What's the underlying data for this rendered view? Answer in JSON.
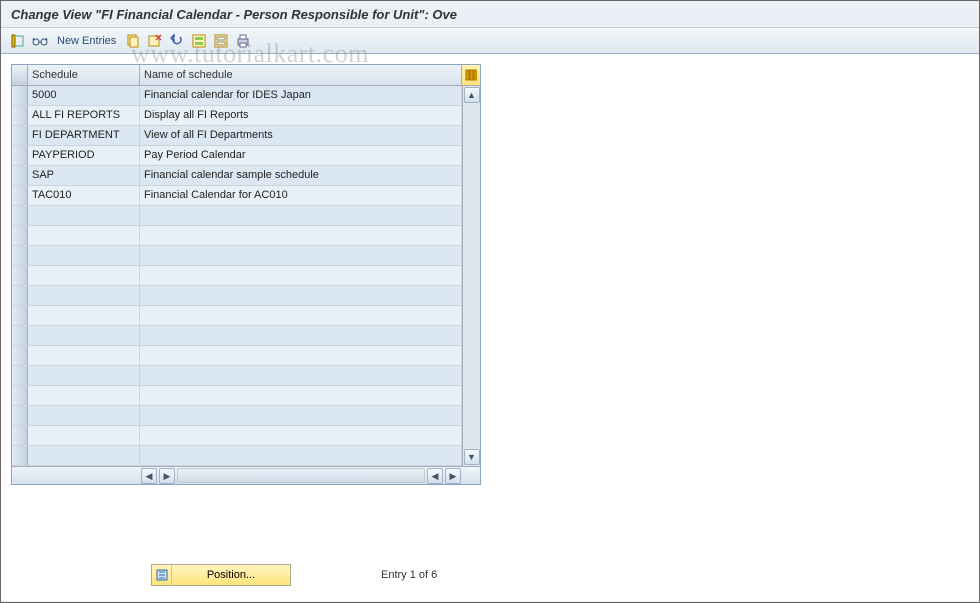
{
  "title": "Change View \"FI Financial Calendar - Person Responsible for Unit\": Ove",
  "toolbar": {
    "new_entries": "New Entries"
  },
  "table": {
    "columns": {
      "schedule": "Schedule",
      "name": "Name of schedule"
    },
    "rows": [
      {
        "schedule": "5000",
        "name": "Financial calendar for IDES Japan"
      },
      {
        "schedule": "ALL FI REPORTS",
        "name": "Display all FI Reports"
      },
      {
        "schedule": "FI DEPARTMENT",
        "name": "View of all FI Departments"
      },
      {
        "schedule": "PAYPERIOD",
        "name": "Pay Period Calendar"
      },
      {
        "schedule": "SAP",
        "name": "Financial calendar sample schedule"
      },
      {
        "schedule": "TAC010",
        "name": "Financial Calendar for AC010"
      }
    ]
  },
  "footer": {
    "position_button": "Position...",
    "entry_text": "Entry 1 of 6"
  },
  "watermark": "www.tutorialkart.com"
}
